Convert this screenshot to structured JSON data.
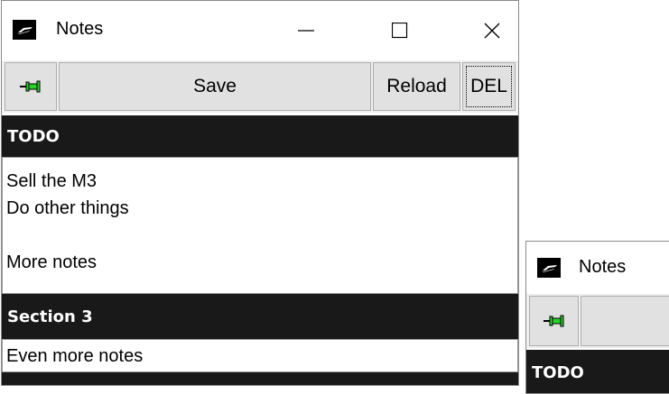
{
  "main_window": {
    "title": "Notes",
    "controls": {
      "minimize": "minimize-icon",
      "maximize": "maximize-icon",
      "close": "close-icon"
    },
    "toolbar": {
      "pin_icon": "pin-icon",
      "save_label": "Save",
      "reload_label": "Reload",
      "delete_label": "DEL"
    },
    "sections": [
      {
        "header": "TODO",
        "lines": [
          "Sell the M3",
          "Do other things",
          "",
          "More notes"
        ]
      },
      {
        "header": "Section 3",
        "lines": [
          "Even more notes"
        ]
      }
    ]
  },
  "second_window": {
    "title": "Notes",
    "toolbar": {
      "pin_icon": "pin-icon"
    },
    "sections": [
      {
        "header": "TODO"
      }
    ]
  },
  "colors": {
    "header_bg": "#191919",
    "header_text": "#ffffff",
    "toolbar_bg": "#f0f0f0",
    "button_bg": "#e1e1e1",
    "pin_green": "#2bd12b"
  }
}
